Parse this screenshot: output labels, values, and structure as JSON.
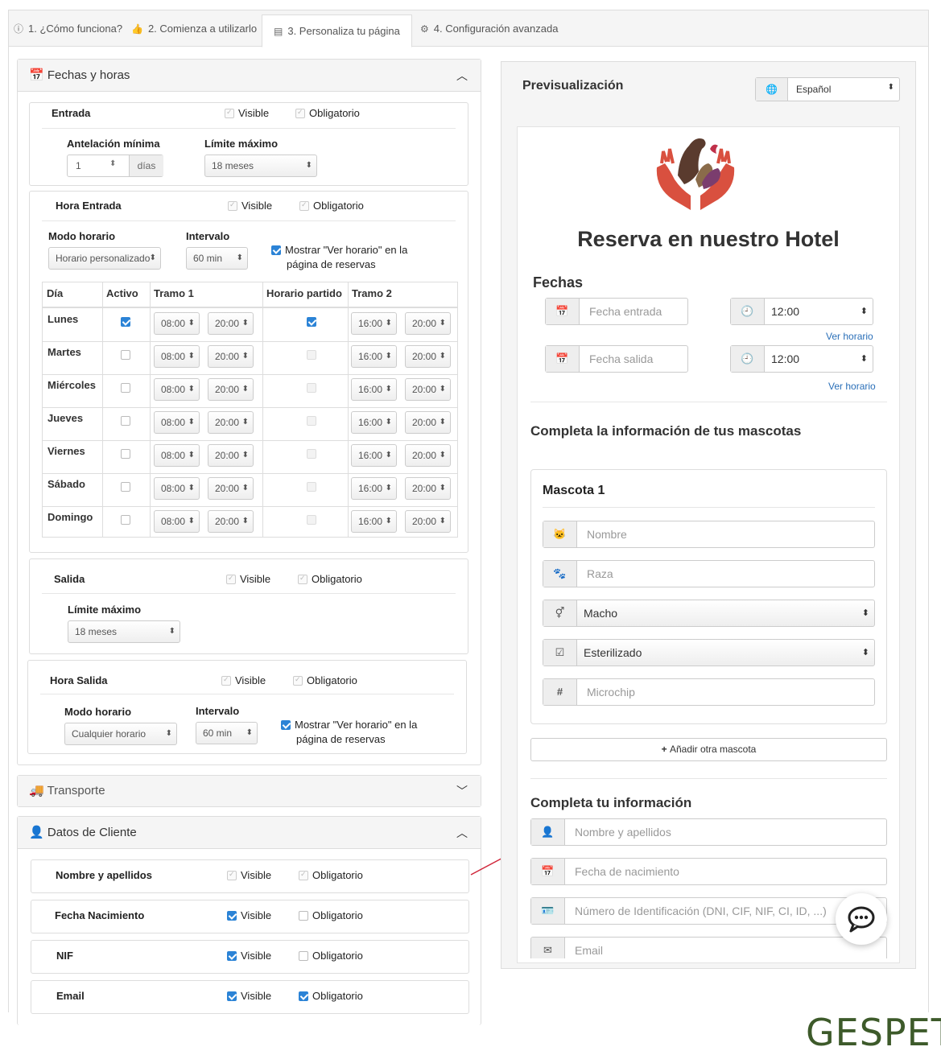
{
  "tabs": [
    {
      "label": "1. ¿Cómo funciona?",
      "icon": "info-icon"
    },
    {
      "label": "2. Comienza a utilizarlo",
      "icon": "thumbs-up-icon"
    },
    {
      "label": "3. Personaliza tu página",
      "icon": "page-icon"
    },
    {
      "label": "4. Configuración avanzada",
      "icon": "cogs-icon"
    }
  ],
  "fechas": {
    "title": "Fechas y horas",
    "entrada": {
      "label": "Entrada",
      "visible": "Visible",
      "obligatorio": "Obligatorio",
      "antelacion_label": "Antelación mínima",
      "antelacion_value": "1",
      "antelacion_unit": "días",
      "limite_label": "Límite máximo",
      "limite_value": "18 meses"
    },
    "hora_entrada": {
      "label": "Hora Entrada",
      "visible": "Visible",
      "obligatorio": "Obligatorio",
      "modo_label": "Modo horario",
      "modo_value": "Horario personalizado",
      "intervalo_label": "Intervalo",
      "intervalo_value": "60 min",
      "mostrar_line1": "Mostrar \"Ver horario\" en la",
      "mostrar_line2": "página de reservas"
    },
    "table": {
      "headers": [
        "Día",
        "Activo",
        "Tramo 1",
        "Horario partido",
        "Tramo 2"
      ],
      "rows": [
        {
          "day": "Lunes",
          "t1a": "08:00",
          "t1b": "20:00",
          "t2a": "16:00",
          "t2b": "20:00"
        },
        {
          "day": "Martes",
          "t1a": "08:00",
          "t1b": "20:00",
          "t2a": "16:00",
          "t2b": "20:00"
        },
        {
          "day": "Miércoles",
          "t1a": "08:00",
          "t1b": "20:00",
          "t2a": "16:00",
          "t2b": "20:00"
        },
        {
          "day": "Jueves",
          "t1a": "08:00",
          "t1b": "20:00",
          "t2a": "16:00",
          "t2b": "20:00"
        },
        {
          "day": "Viernes",
          "t1a": "08:00",
          "t1b": "20:00",
          "t2a": "16:00",
          "t2b": "20:00"
        },
        {
          "day": "Sábado",
          "t1a": "08:00",
          "t1b": "20:00",
          "t2a": "16:00",
          "t2b": "20:00"
        },
        {
          "day": "Domingo",
          "t1a": "08:00",
          "t1b": "20:00",
          "t2a": "16:00",
          "t2b": "20:00"
        }
      ]
    },
    "salida": {
      "label": "Salida",
      "visible": "Visible",
      "obligatorio": "Obligatorio",
      "limite_label": "Límite máximo",
      "limite_value": "18 meses"
    },
    "hora_salida": {
      "label": "Hora Salida",
      "visible": "Visible",
      "obligatorio": "Obligatorio",
      "modo_label": "Modo horario",
      "modo_value": "Cualquier horario",
      "intervalo_label": "Intervalo",
      "intervalo_value": "60 min",
      "mostrar_line1": "Mostrar \"Ver horario\" en la",
      "mostrar_line2": "página de reservas"
    }
  },
  "transporte": {
    "title": "Transporte"
  },
  "cliente": {
    "title": "Datos de Cliente",
    "rows": [
      {
        "label": "Nombre y apellidos",
        "visible": "Visible",
        "obligatorio": "Obligatorio"
      },
      {
        "label": "Fecha Nacimiento",
        "visible": "Visible",
        "obligatorio": "Obligatorio"
      },
      {
        "label": "NIF",
        "visible": "Visible",
        "obligatorio": "Obligatorio"
      },
      {
        "label": "Email",
        "visible": "Visible",
        "obligatorio": "Obligatorio"
      }
    ]
  },
  "preview": {
    "title": "Previsualización",
    "language": "Español",
    "heading": "Reserva en nuestro Hotel",
    "fechas_label": "Fechas",
    "fecha_entrada_ph": "Fecha entrada",
    "fecha_salida_ph": "Fecha salida",
    "hora_entrada": "12:00",
    "hora_salida": "12:00",
    "ver_horario": "Ver horario",
    "mascotas_heading": "Completa la información de tus mascotas",
    "mascota_title": "Mascota 1",
    "nombre_ph": "Nombre",
    "raza_ph": "Raza",
    "sexo_value": "Macho",
    "esterilizado_value": "Esterilizado",
    "microchip_ph": "Microchip",
    "add_pet": "Añadir otra mascota",
    "info_heading": "Completa tu información",
    "nombre_apellidos_ph": "Nombre y apellidos",
    "fecha_nac_ph": "Fecha de nacimiento",
    "id_ph": "Número de Identificación (DNI, CIF, NIF, CI, ID, ...)",
    "email_ph": "Email"
  },
  "brand": "GESPET",
  "colors": {
    "accent": "#2b83d6",
    "link": "#2a6fb8",
    "brand": "#3d5a2a",
    "arrow": "#d0263a"
  }
}
